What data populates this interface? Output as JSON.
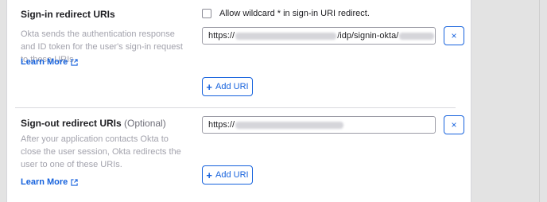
{
  "signin": {
    "title": "Sign-in redirect URIs",
    "description": "Okta sends the authentication response and ID token for the user's sign-in request to these URIs",
    "learn_more": "Learn More",
    "wildcard_label": "Allow wildcard * in sign-in URI redirect.",
    "wildcard_checked": false,
    "uri_prefix": "https://",
    "uri_middle": "/idp/signin-okta/",
    "remove_label": "×",
    "add_label": "Add URI"
  },
  "signout": {
    "title": "Sign-out redirect URIs",
    "optional_label": "(Optional)",
    "description": "After your application contacts Okta to close the user session, Okta redirects the user to one of these URIs.",
    "learn_more": "Learn More",
    "uri_prefix": "https://",
    "remove_label": "×",
    "add_label": "Add URI"
  },
  "colors": {
    "accent": "#1662dd",
    "muted_text": "#a3a3ad",
    "background": "#e3e3e3"
  }
}
